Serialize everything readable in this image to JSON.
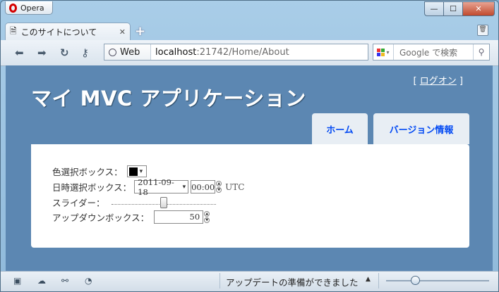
{
  "window": {
    "menu_button_label": "Opera",
    "minimize_glyph": "—",
    "maximize_glyph": "☐",
    "close_glyph": "✕"
  },
  "tabs": [
    {
      "label": "このサイトについて",
      "close_glyph": "✕",
      "icon": "page-icon"
    }
  ],
  "new_tab_glyph": "+",
  "toolbar": {
    "back_glyph": "⬅",
    "forward_glyph": "➡",
    "reload_glyph": "↻",
    "key_glyph": "⚷",
    "address_badge": "Web",
    "url_host": "localhost",
    "url_path": ":21742/Home/About",
    "search_placeholder": "Google で検索",
    "search_glyph": "⚲"
  },
  "page": {
    "login_prefix": "[ ",
    "login_link": "ログオン",
    "login_suffix": " ]",
    "app_title": "マイ MVC アプリケーション",
    "menu": [
      {
        "label": "ホーム"
      },
      {
        "label": "バージョン情報"
      }
    ],
    "form": {
      "color_label": "色選択ボックス：",
      "color_value": "#000000",
      "color_arrow": "▾",
      "datetime_label": "日時選択ボックス：",
      "date_value": "2011-09-18",
      "date_arrow": "▾",
      "time_value": "00:00",
      "tz_label": "UTC",
      "slider_label": "スライダー：",
      "slider_level": 0.5,
      "updown_label": "アップダウンボックス：",
      "updown_value": "50",
      "spin_up": "▲",
      "spin_down": "▼"
    }
  },
  "statusbar": {
    "icons": [
      "panel-icon",
      "cloud-icon",
      "share-icon",
      "speed-dial-icon"
    ],
    "message": "アップデートの準備ができました",
    "arrow_glyph": "▲",
    "zoom_level": 0.3
  },
  "colors": {
    "page_background": "#5c87b2",
    "menu_link": "#034af3",
    "close_button": "#c14a2e"
  }
}
